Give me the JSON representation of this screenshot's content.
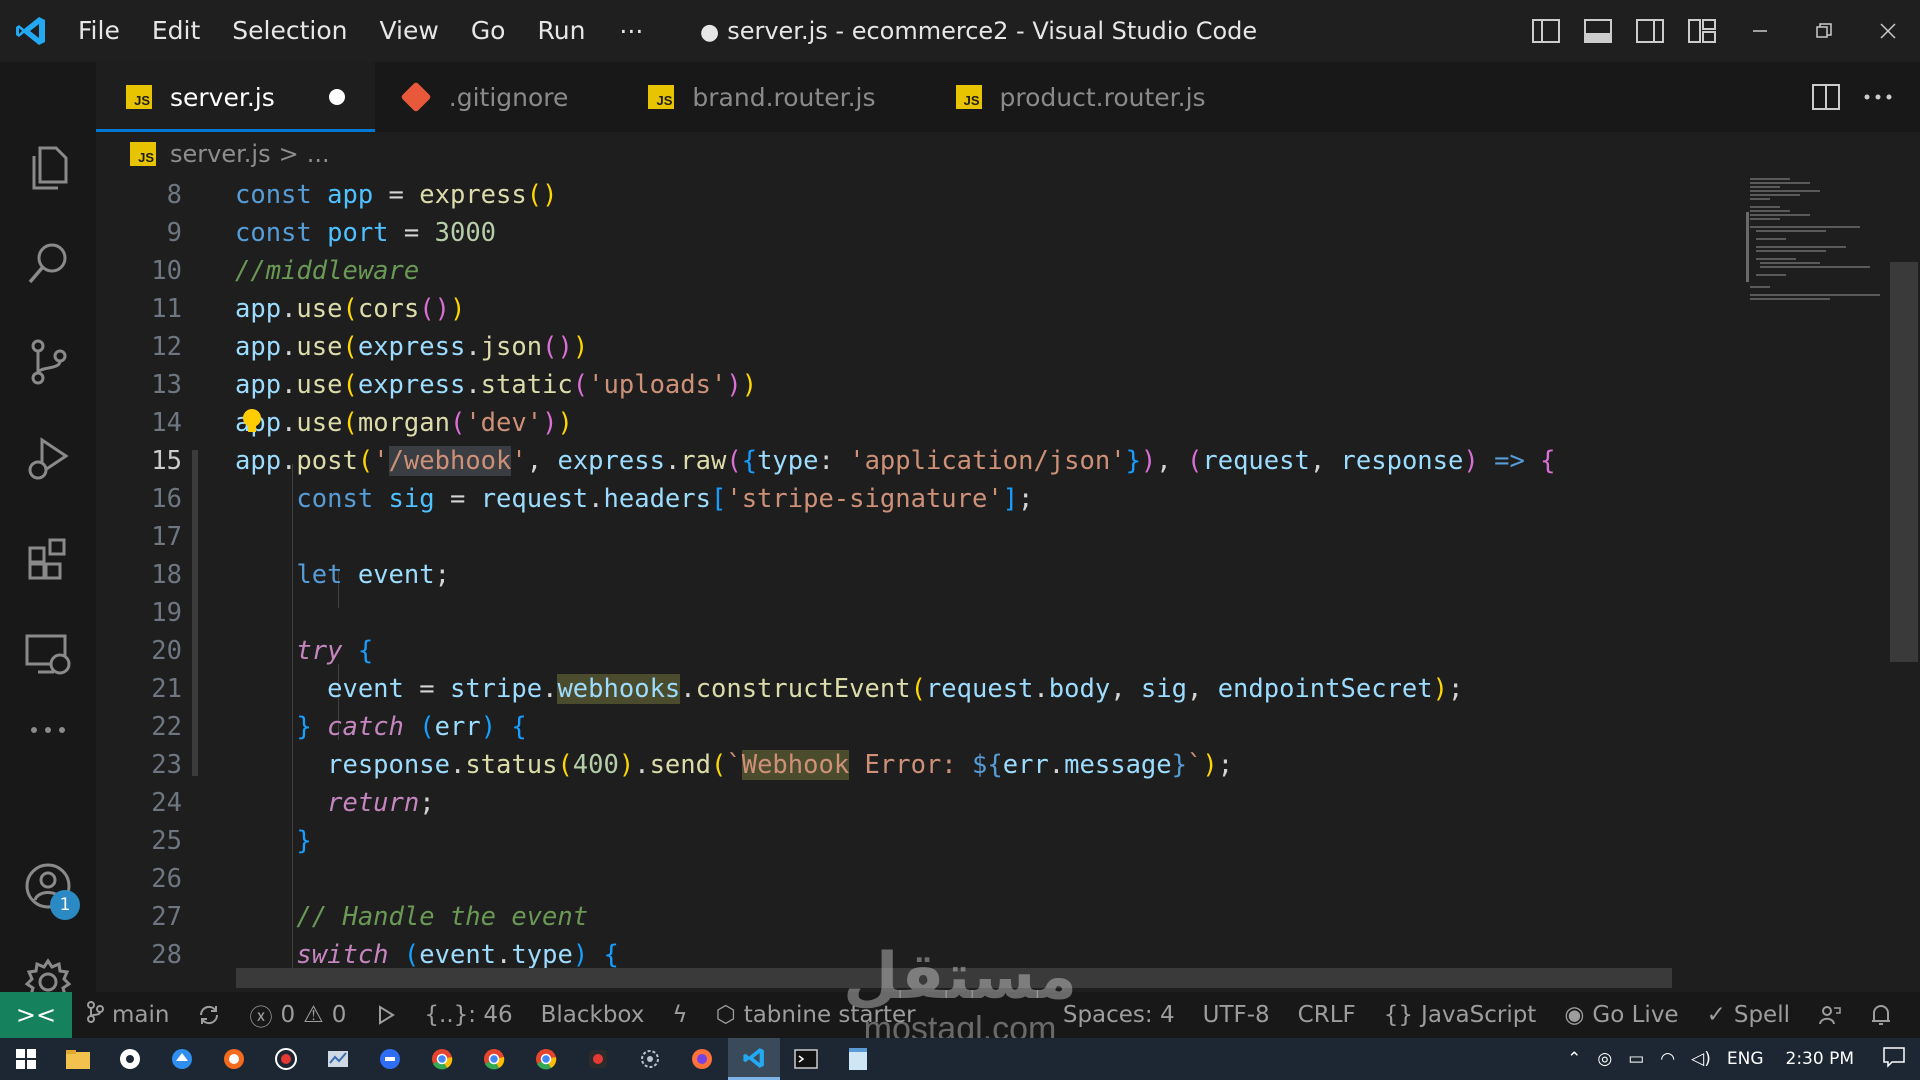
{
  "window": {
    "title": "server.js - ecommerce2 - Visual Studio Code",
    "modified_dot": "●"
  },
  "menu": {
    "items": [
      "File",
      "Edit",
      "Selection",
      "View",
      "Go",
      "Run"
    ],
    "more": "···"
  },
  "tabs": [
    {
      "label": "server.js",
      "icon": "js-file-icon",
      "active": true,
      "dirty": true
    },
    {
      "label": ".gitignore",
      "icon": "git-file-icon",
      "active": false
    },
    {
      "label": "brand.router.js",
      "icon": "js-file-icon",
      "active": false
    },
    {
      "label": "product.router.js",
      "icon": "js-file-icon",
      "active": false
    }
  ],
  "breadcrumb": {
    "file": "server.js",
    "separator": ">",
    "rest": "..."
  },
  "activity": {
    "items": [
      "explorer-icon",
      "search-icon",
      "source-control-icon",
      "run-debug-icon",
      "extensions-icon",
      "remote-explorer-icon",
      "more-icon"
    ],
    "account_badge": "1"
  },
  "editor": {
    "line_numbers": [
      "8",
      "9",
      "10",
      "11",
      "12",
      "13",
      "14",
      "15",
      "16",
      "17",
      "18",
      "19",
      "20",
      "21",
      "22",
      "23",
      "24",
      "25",
      "26",
      "27",
      "28"
    ],
    "language": "javascript"
  },
  "statusbar": {
    "branch": "main",
    "errors": "0",
    "warnings": "0",
    "bracket_info": "{..}: 46",
    "blackbox": "Blackbox",
    "tabnine": "tabnine starter",
    "spaces": "Spaces: 4",
    "encoding": "UTF-8",
    "eol": "CRLF",
    "language": "JavaScript",
    "golive": "Go Live",
    "spell": "Spell"
  },
  "watermark": {
    "arabic": "مستقل",
    "latin": "mostaql.com"
  },
  "taskbar": {
    "lang": "ENG",
    "time": "2:30 PM"
  },
  "colors": {
    "accent": "#0078d4",
    "remote": "#16825d",
    "js_icon": "#e8c300",
    "git_icon": "#e8593c"
  }
}
